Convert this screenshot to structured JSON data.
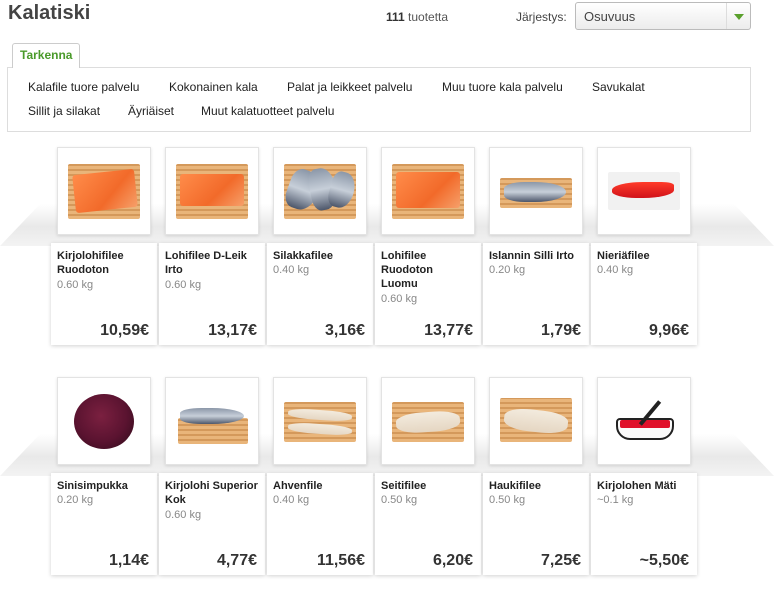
{
  "header": {
    "title": "Kalatiski",
    "count_number": "111",
    "count_suffix": " tuotetta",
    "sort_label": "Järjestys:",
    "sort_value": "Osuvuus"
  },
  "filter": {
    "tab_label": "Tarkenna",
    "categories": [
      "Kalafile tuore palvelu",
      "Kokonainen kala",
      "Palat ja leikkeet palvelu",
      "Muu tuore kala palvelu",
      "Savukalat",
      "Sillit ja silakat",
      "Äyriäiset",
      "Muut kalatuotteet palvelu"
    ]
  },
  "products": [
    {
      "name": "Kirjolohifilee Ruodoton",
      "weight": "0.60 kg",
      "price": "10,59€",
      "image": "salmon-fillet-image"
    },
    {
      "name": "Lohifilee D-Leik Irto",
      "weight": "0.60 kg",
      "price": "13,17€",
      "image": "salmon-fillet-image"
    },
    {
      "name": "Silakkafilee",
      "weight": "0.40 kg",
      "price": "3,16€",
      "image": "herring-fillet-image"
    },
    {
      "name": "Lohifilee Ruodoton Luomu",
      "weight": "0.60 kg",
      "price": "13,77€",
      "image": "salmon-fillet-image"
    },
    {
      "name": "Islannin Silli Irto",
      "weight": "0.20 kg",
      "price": "1,79€",
      "image": "herring-image"
    },
    {
      "name": "Nieriäfilee",
      "weight": "0.40 kg",
      "price": "9,96€",
      "image": "char-fillet-image"
    },
    {
      "name": "Sinisimpukka",
      "weight": "0.20 kg",
      "price": "1,14€",
      "image": "mussels-image"
    },
    {
      "name": "Kirjolohi Superior Kok",
      "weight": "0.60 kg",
      "price": "4,77€",
      "image": "whole-trout-image"
    },
    {
      "name": "Ahvenfile",
      "weight": "0.40 kg",
      "price": "11,56€",
      "image": "white-fillet-image"
    },
    {
      "name": "Seitifilee",
      "weight": "0.50 kg",
      "price": "6,20€",
      "image": "white-fillet-image"
    },
    {
      "name": "Haukifilee",
      "weight": "0.50 kg",
      "price": "7,25€",
      "image": "white-fillet-image"
    },
    {
      "name": "Kirjolohen Mäti",
      "weight": "~0.1 kg",
      "price": "~5,50€",
      "image": "roe-bowl-image"
    }
  ],
  "colors": {
    "accent_green": "#4a9a2a",
    "salmon": "#f26a2a"
  }
}
